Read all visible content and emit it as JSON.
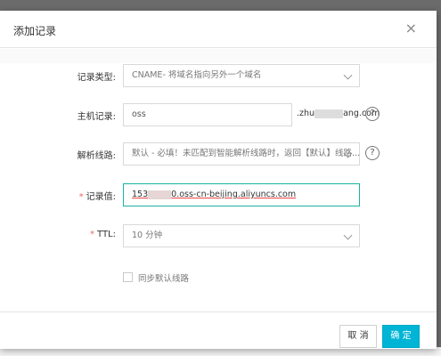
{
  "dialog": {
    "title": "添加记录",
    "close_glyph": "×"
  },
  "form": {
    "record_type": {
      "label": "记录类型:",
      "value": "CNAME- 将域名指向另外一个域名"
    },
    "host": {
      "label": "主机记录:",
      "value": "oss",
      "suffix_start": ".zhu",
      "suffix_end": "ang.com",
      "help_glyph": "?"
    },
    "line": {
      "label": "解析线路:",
      "value": "默认 - 必填！未匹配到智能解析线路时，返回【默认】线路...",
      "help_glyph": "?"
    },
    "record_value": {
      "required_mark": "*",
      "label": "记录值:",
      "value_start": "153",
      "value_end": "0.oss-cn-beijing.aliyuncs.com"
    },
    "ttl": {
      "required_mark": "*",
      "label": "TTL:",
      "value": "10 分钟"
    },
    "sync_default": {
      "label": "同步默认线路",
      "checked": false
    }
  },
  "footer": {
    "cancel_label": "取 消",
    "ok_label": "确 定"
  },
  "colors": {
    "primary": "#00b4d6",
    "focus_border": "#18b3a3",
    "required": "#e66666"
  }
}
